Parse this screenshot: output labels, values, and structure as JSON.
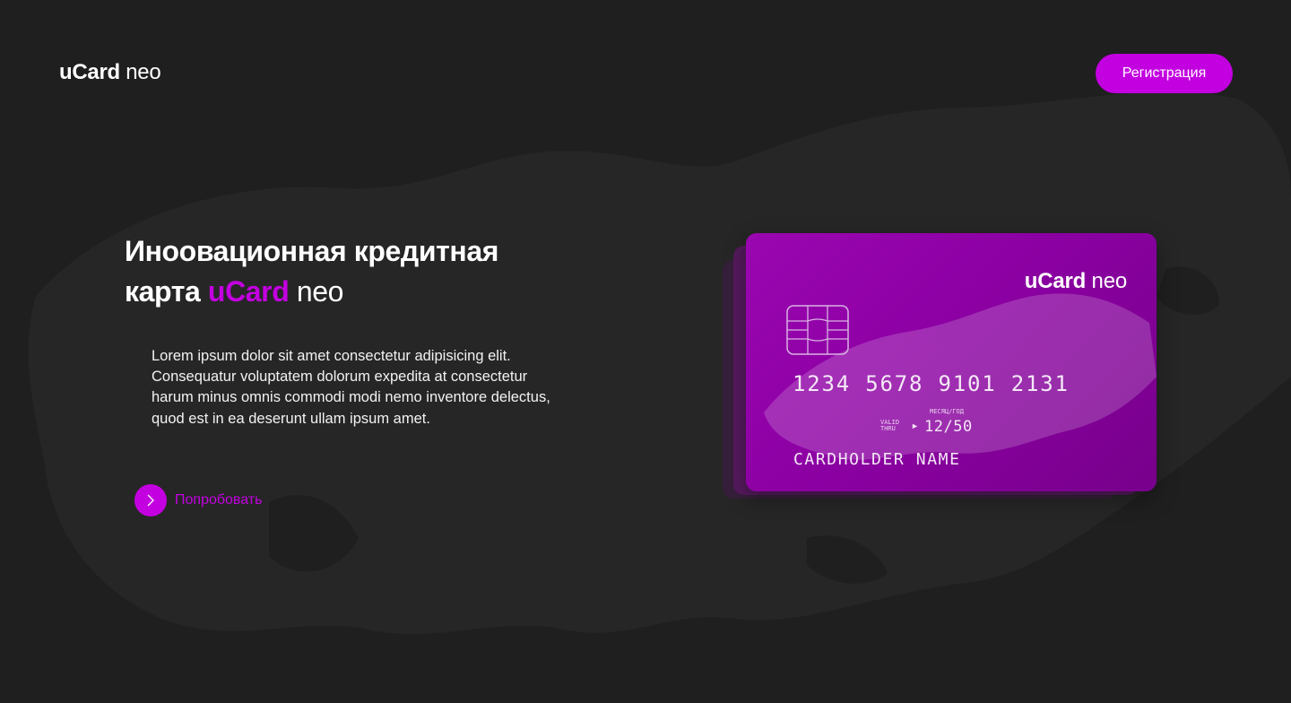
{
  "header": {
    "logo_brand": "uCard",
    "logo_sub": "neo",
    "register_label": "Регистрация"
  },
  "hero": {
    "title_line1": "Иноовационная кредитная",
    "title_line2_prefix": "карта",
    "title_brand": "uCard",
    "title_sub": "neo",
    "description": "Lorem ipsum dolor sit amet consectetur adipisicing elit. Consequatur voluptatem dolorum expedita at consectetur harum minus omnis commodi modi nemo inventore delectus, quod est in ea deserunt ullam ipsum amet.",
    "cta_label": "Попробовать",
    "cta_icon": "chevron-right-icon"
  },
  "card": {
    "logo_brand": "uCard",
    "logo_sub": "neo",
    "number": "1234 5678 9101 2131",
    "valid_line1": "VALID",
    "valid_line2": "THRU",
    "expiry_caption": "МЕСЯЦ/ГОД",
    "expiry": "12/50",
    "holder": "CARDHOLDER NAME"
  },
  "colors": {
    "background": "#1f1f1f",
    "accent": "#c300e0",
    "card": "#8c00a3"
  }
}
